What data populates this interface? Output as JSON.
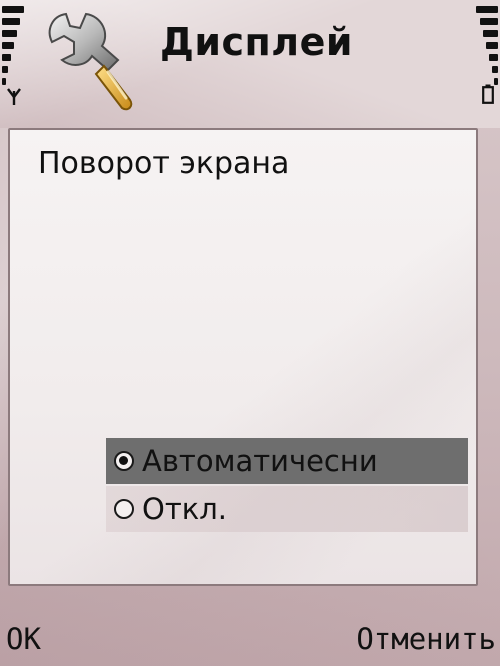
{
  "status": {
    "signal_icon": "signal-strength-icon",
    "antenna_icon": "antenna-icon",
    "battery_icon": "battery-icon"
  },
  "header": {
    "title": "Дисплей",
    "app_icon": "wrench-settings-icon"
  },
  "setting": {
    "label": "Поворот экрана",
    "options": [
      {
        "label": "Автоматичесни",
        "selected": true
      },
      {
        "label": "Откл.",
        "selected": false
      }
    ]
  },
  "softkeys": {
    "left": "OK",
    "right": "Отменить"
  },
  "colors": {
    "highlight": "#6e6e6e",
    "text": "#111111",
    "panel_border": "#8c7a7d"
  }
}
